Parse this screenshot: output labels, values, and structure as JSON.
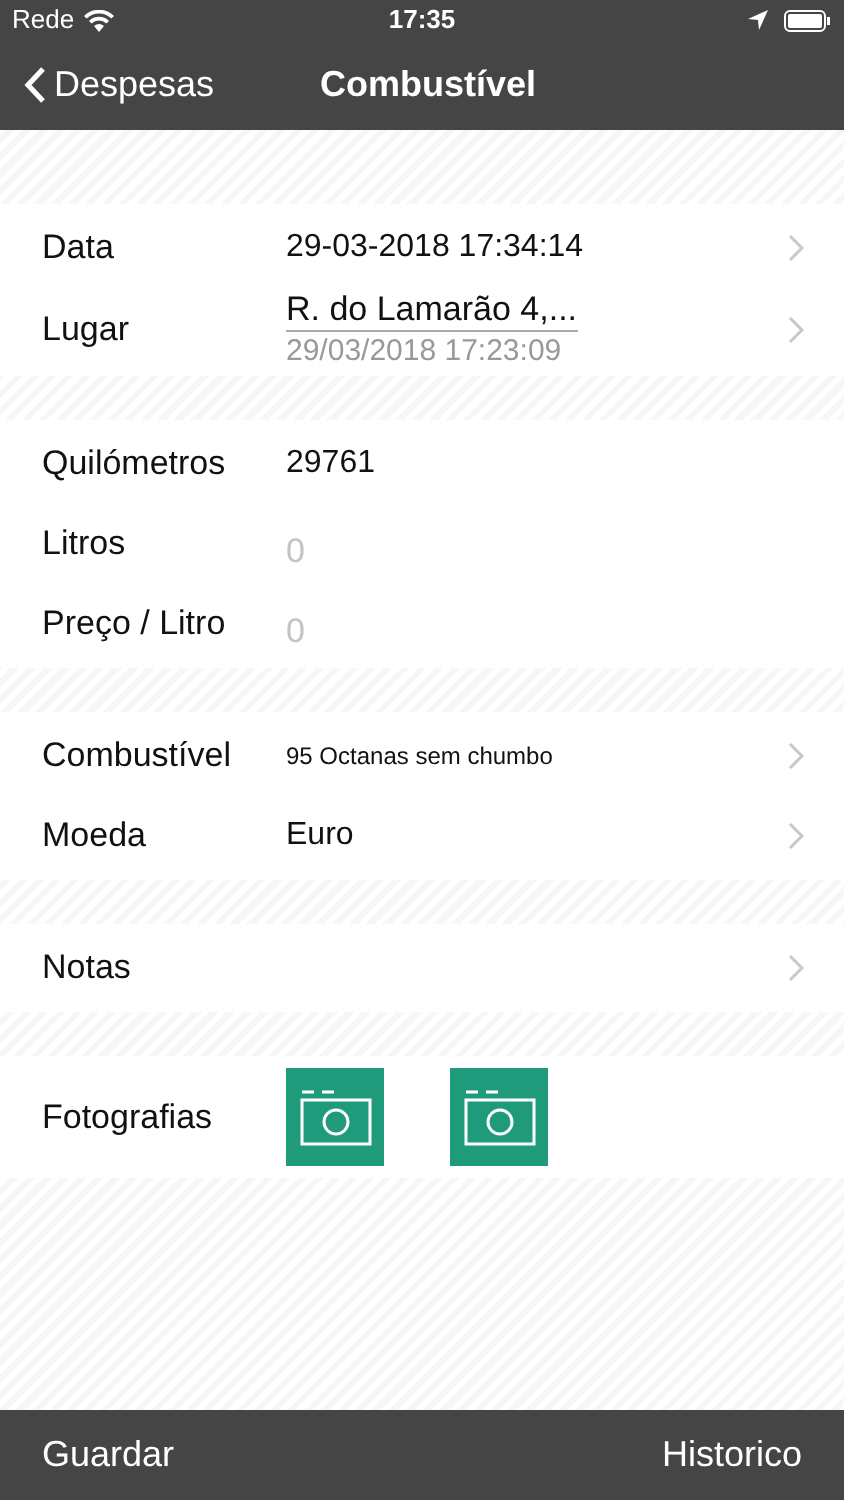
{
  "status_bar": {
    "carrier": "Rede",
    "time": "17:35"
  },
  "nav": {
    "back": "Despesas",
    "title": "Combustível"
  },
  "sections": [
    {
      "rows": [
        {
          "kind": "value",
          "label": "Data",
          "value": "29-03-2018 17:34:14",
          "chevron": true
        },
        {
          "kind": "place",
          "label": "Lugar",
          "value": "R. do Lamarão 4,...",
          "subtitle": "29/03/2018 17:23:09",
          "chevron": true
        }
      ]
    },
    {
      "rows": [
        {
          "kind": "value",
          "label": "Quilómetros",
          "value": "29761",
          "chevron": false
        },
        {
          "kind": "input",
          "label": "Litros",
          "placeholder": "0",
          "chevron": false
        },
        {
          "kind": "input",
          "label": "Preço / Litro",
          "placeholder": "0",
          "chevron": false
        }
      ]
    },
    {
      "rows": [
        {
          "kind": "small",
          "label": "Combustível",
          "value": "95 Octanas sem chumbo",
          "chevron": true
        },
        {
          "kind": "value",
          "label": "Moeda",
          "value": "Euro",
          "chevron": true
        }
      ]
    },
    {
      "rows": [
        {
          "kind": "value",
          "label": "Notas",
          "chevron": true
        }
      ]
    },
    {
      "rows": [
        {
          "kind": "photos",
          "label": "Fotografias",
          "photos": [
            {
              "kind": "camera"
            },
            {
              "kind": "camera"
            }
          ],
          "chevron": false
        }
      ]
    }
  ],
  "toolbar": {
    "left": "Guardar",
    "right": "Historico"
  }
}
